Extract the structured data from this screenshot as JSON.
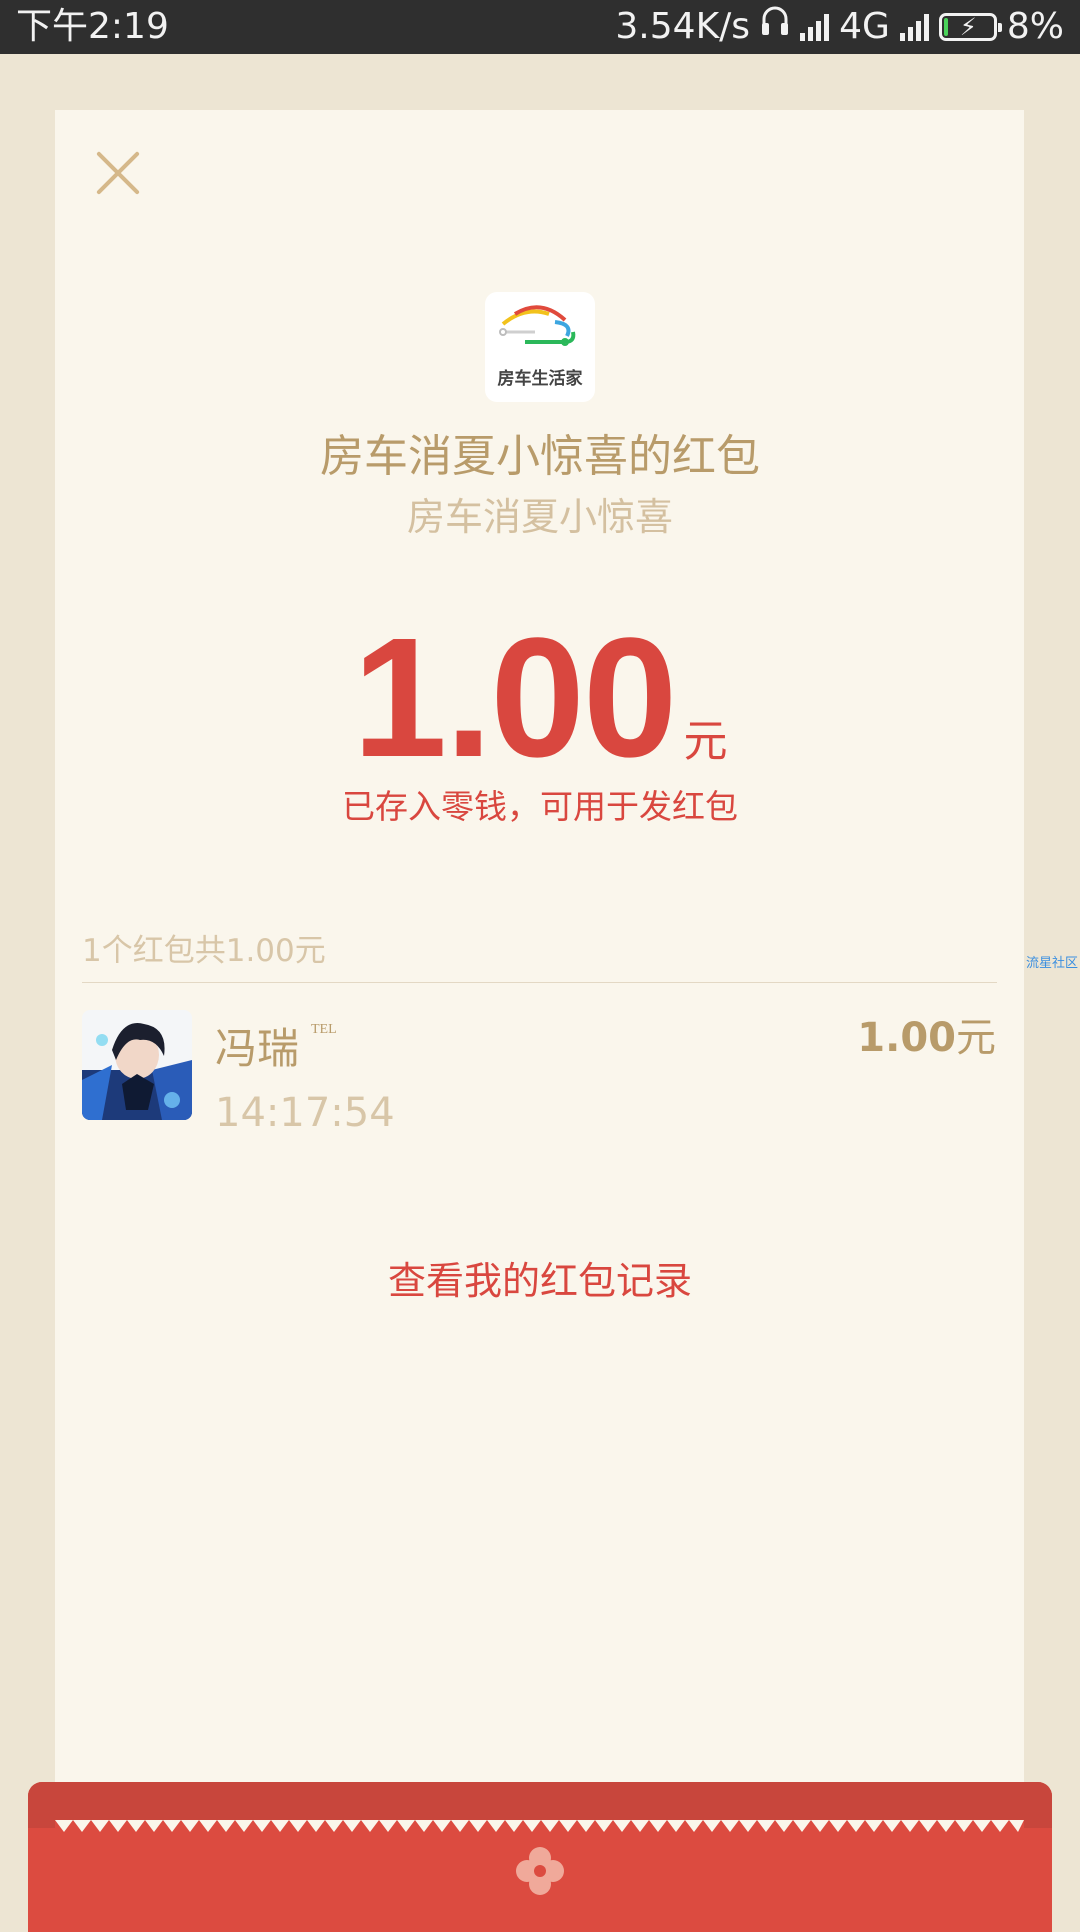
{
  "status_bar": {
    "time": "下午2:19",
    "speed": "3.54K/s",
    "network": "4G",
    "battery": "8%",
    "battery_level": 0.08,
    "accent_battery": "#4ad25a"
  },
  "packet": {
    "logo_text": "房车生活家",
    "sender_title": "房车消夏小惊喜的红包",
    "greeting": "房车消夏小惊喜",
    "amount": "1.00",
    "amount_unit": "元",
    "stored_note": "已存入零钱，可用于发红包"
  },
  "receipts": {
    "summary": "1个红包共1.00元",
    "items": [
      {
        "name": "冯瑞",
        "tag": "TEL",
        "time": "14:17:54",
        "amount": "1.00",
        "amount_unit": "元"
      }
    ]
  },
  "history_link": "查看我的红包记录",
  "side_watermark": "流星社区",
  "colors": {
    "accent_red": "#d9473f",
    "gold_text": "#b89b6a",
    "card_bg": "#faf6ec",
    "page_bg": "#ede5d3"
  },
  "icons": {
    "close": "close-icon",
    "headphones": "headphones-icon",
    "signal": "signal-icon",
    "battery": "battery-charging-icon",
    "flower": "flower-icon"
  }
}
